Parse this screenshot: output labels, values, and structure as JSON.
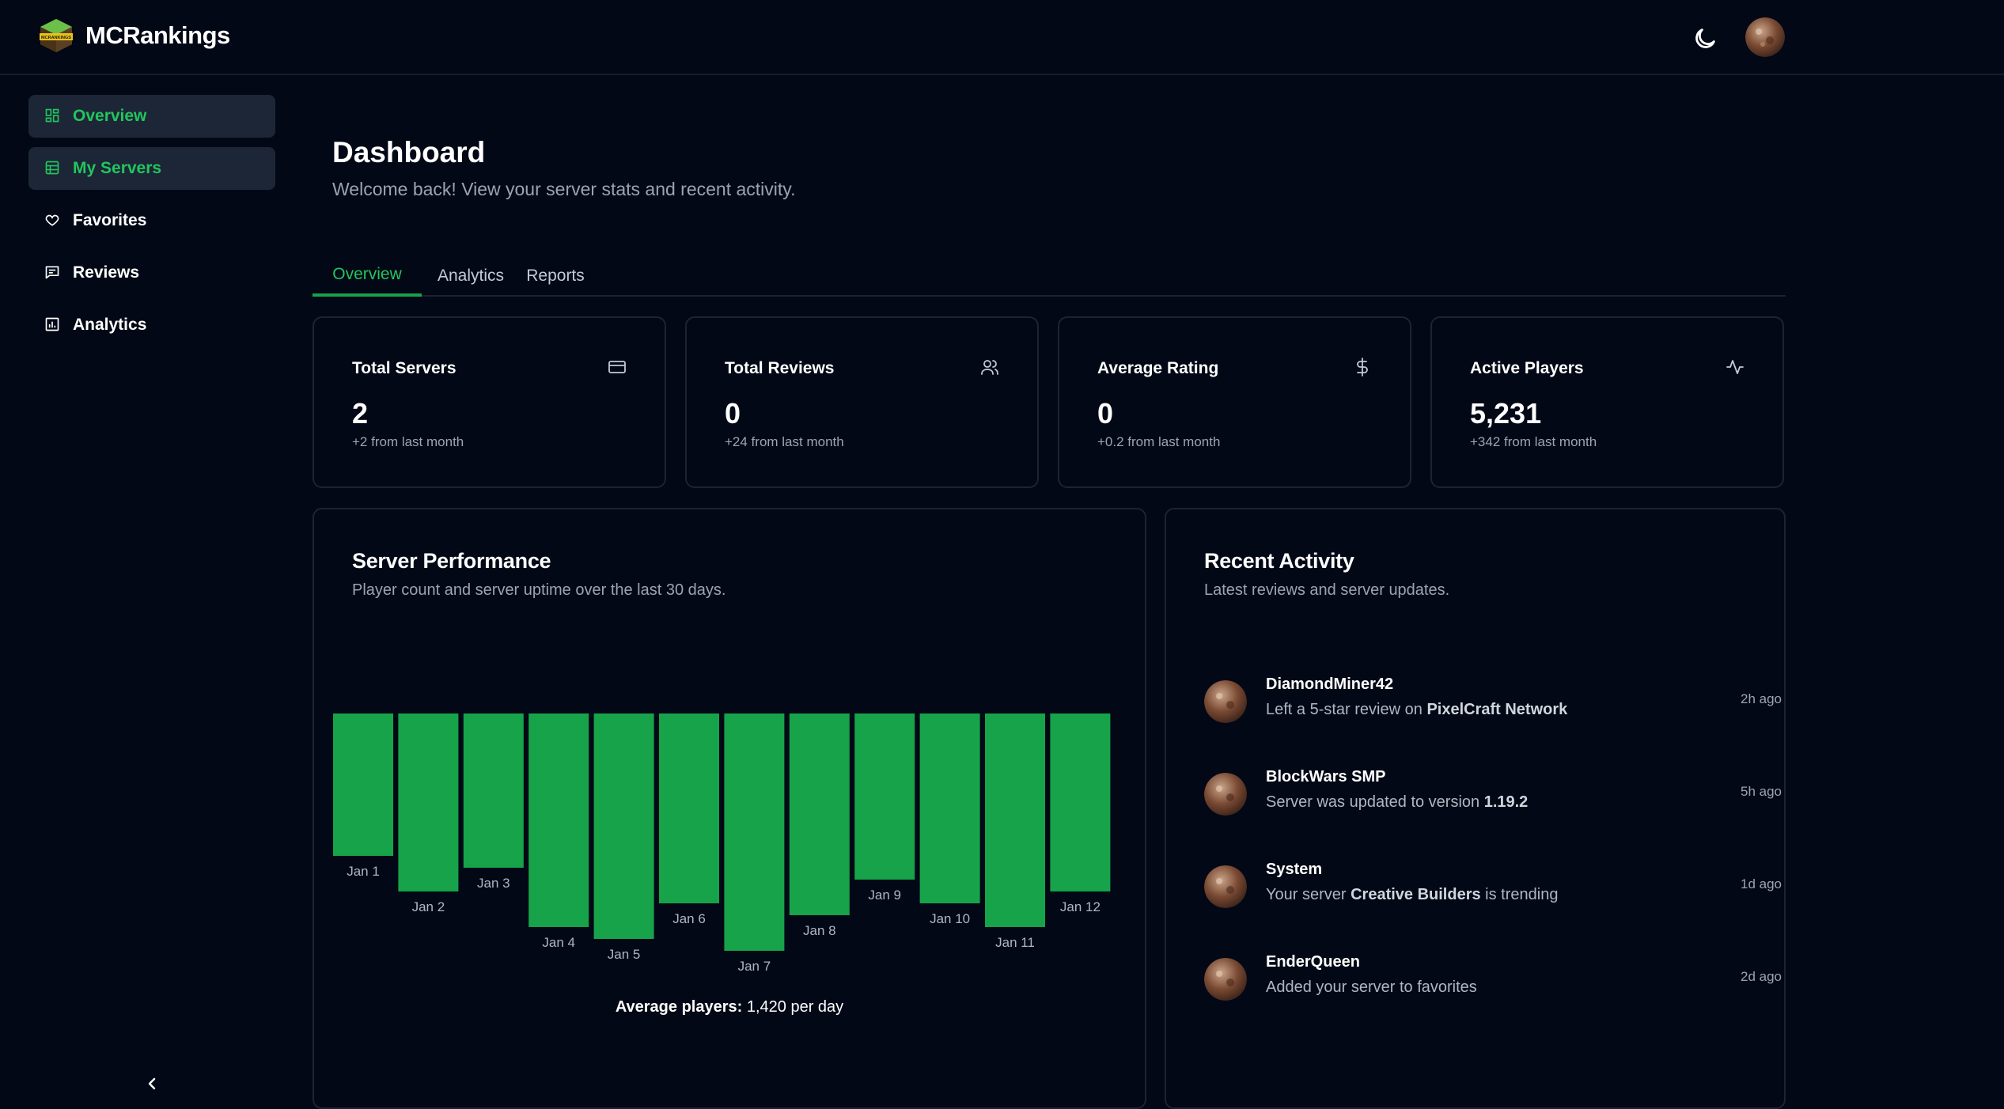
{
  "header": {
    "brand": "MCRankings",
    "logo_text": "MCRANKINGS",
    "theme_icon": "moon-icon",
    "avatar_icon": "user-avatar"
  },
  "sidebar": {
    "items": [
      {
        "label": "Overview",
        "icon": "grid-icon",
        "active": true
      },
      {
        "label": "My Servers",
        "icon": "server-icon",
        "active": true
      },
      {
        "label": "Favorites",
        "icon": "heart-icon",
        "active": false
      },
      {
        "label": "Reviews",
        "icon": "message-icon",
        "active": false
      },
      {
        "label": "Analytics",
        "icon": "bar-chart-icon",
        "active": false
      }
    ],
    "collapse_icon": "chevron-left-icon"
  },
  "page": {
    "title": "Dashboard",
    "subtitle": "Welcome back! View your server stats and recent activity."
  },
  "tabs": [
    {
      "label": "Overview",
      "active": true
    },
    {
      "label": "Analytics",
      "active": false
    },
    {
      "label": "Reports",
      "active": false
    }
  ],
  "stats": [
    {
      "label": "Total Servers",
      "value": "2",
      "change": "+2 from last month",
      "icon": "credit-card-icon"
    },
    {
      "label": "Total Reviews",
      "value": "0",
      "change": "+24 from last month",
      "icon": "users-icon"
    },
    {
      "label": "Average Rating",
      "value": "0",
      "change": "+0.2 from last month",
      "icon": "dollar-icon"
    },
    {
      "label": "Active Players",
      "value": "5,231",
      "change": "+342 from last month",
      "icon": "activity-icon"
    }
  ],
  "performance": {
    "title": "Server Performance",
    "subtitle": "Player count and server uptime over the last 30 days.",
    "avg_label": "Average players:",
    "avg_value": "1,420 per day"
  },
  "chart_data": {
    "type": "bar",
    "categories": [
      "Jan 1",
      "Jan 2",
      "Jan 3",
      "Jan 4",
      "Jan 5",
      "Jan 6",
      "Jan 7",
      "Jan 8",
      "Jan 9",
      "Jan 10",
      "Jan 11",
      "Jan 12"
    ],
    "values": [
      1200,
      1500,
      1300,
      1800,
      1900,
      1600,
      2000,
      1700,
      1400,
      1600,
      1800,
      1500
    ],
    "color": "#16a34a",
    "ylim": [
      0,
      2000
    ],
    "grid": false,
    "legend": "none"
  },
  "activity": {
    "title": "Recent Activity",
    "subtitle": "Latest reviews and server updates.",
    "items": [
      {
        "name": "DiamondMiner42",
        "pre": "Left a 5-star review on ",
        "bold": "PixelCraft Network",
        "post": "",
        "time": "2h ago"
      },
      {
        "name": "BlockWars SMP",
        "pre": "Server was updated to version ",
        "bold": "1.19.2",
        "post": "",
        "time": "5h ago"
      },
      {
        "name": "System",
        "pre": "Your server ",
        "bold": "Creative Builders",
        "post": " is trending",
        "time": "1d ago"
      },
      {
        "name": "EnderQueen",
        "pre": "Added your server to favorites",
        "bold": "",
        "post": "",
        "time": "2d ago"
      }
    ]
  }
}
